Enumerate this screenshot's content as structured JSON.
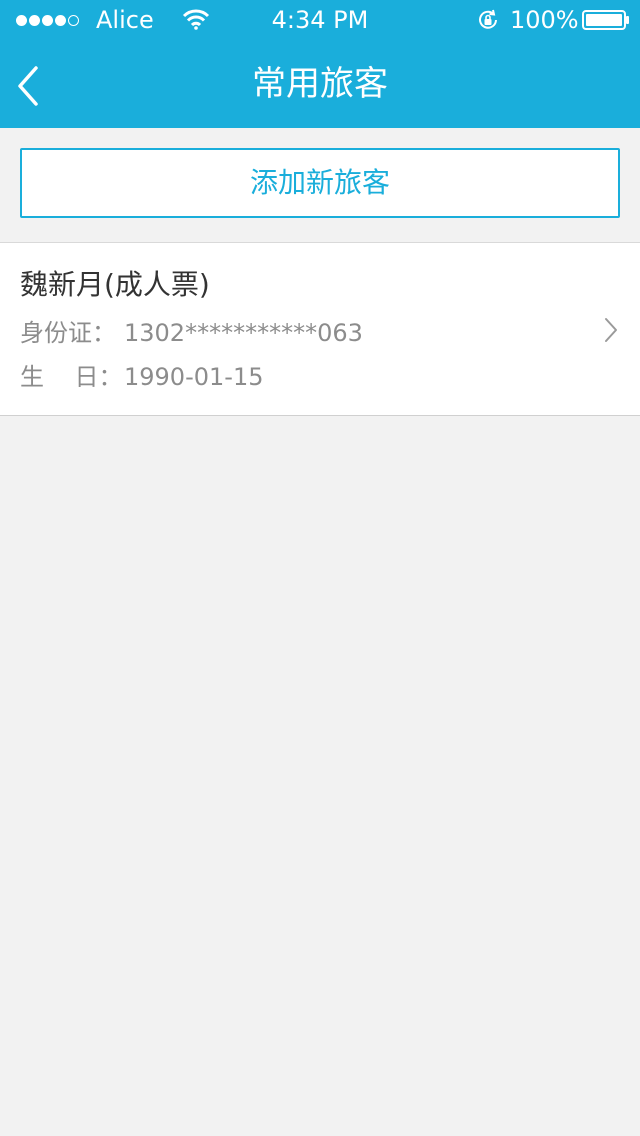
{
  "status_bar": {
    "carrier": "Alice",
    "time": "4:34 PM",
    "battery": "100%"
  },
  "nav": {
    "title": "常用旅客",
    "back_icon": "chevron-left-icon"
  },
  "add_button": {
    "label": "添加新旅客"
  },
  "passengers": [
    {
      "name": "魏新月(成人票)",
      "id_label": "身份证：",
      "id_value": "1302***********063",
      "birthday_label": "生    日：",
      "birthday_value": "1990-01-15"
    }
  ],
  "colors": {
    "accent": "#1aaedb",
    "background": "#f2f2f2",
    "card": "#ffffff",
    "primary_text": "#333333",
    "secondary_text": "#8c8c8c"
  }
}
